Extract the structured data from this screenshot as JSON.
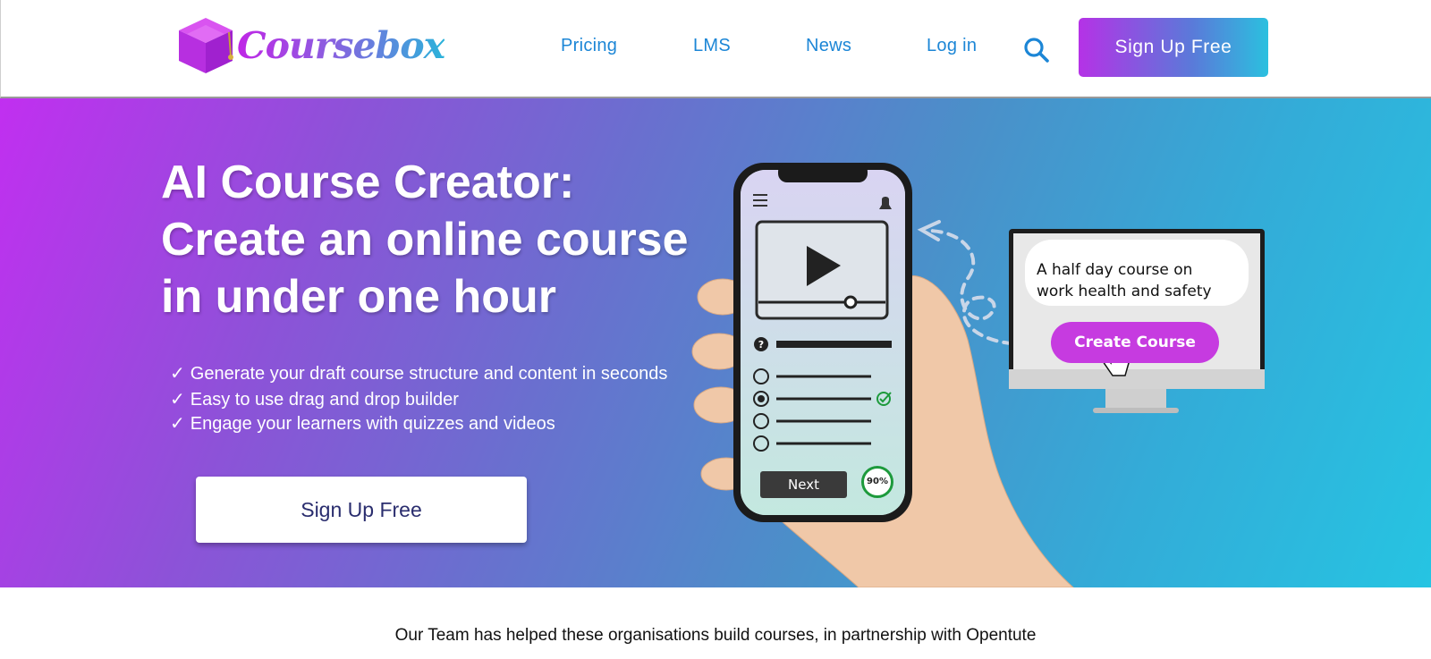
{
  "brand": {
    "name": "Coursebox"
  },
  "nav": {
    "pricing": "Pricing",
    "lms": "LMS",
    "news": "News",
    "login": "Log in",
    "search_icon": "search-icon",
    "signup": "Sign Up Free"
  },
  "hero": {
    "title_line1": "AI Course Creator:",
    "title_line2": "Create an online course",
    "title_line3": "in under one hour",
    "check_mark": "✓",
    "features": [
      "Generate your draft course structure and content in seconds",
      "Easy to use drag and drop builder",
      "Engage your learners with quizzes and videos"
    ],
    "cta": "Sign Up Free"
  },
  "illustration": {
    "bubble_line1": "A half day course on",
    "bubble_line2": "work health and safety",
    "create_button": "Create Course",
    "next_button": "Next",
    "progress": "90%"
  },
  "partners": {
    "text": "Our Team has helped these organisations build courses, in partnership with Opentute"
  },
  "colors": {
    "nav_link": "#1c86d6",
    "gradient_start": "#c12ff0",
    "gradient_end": "#26c4e2",
    "cta_text": "#2a2d6e"
  }
}
